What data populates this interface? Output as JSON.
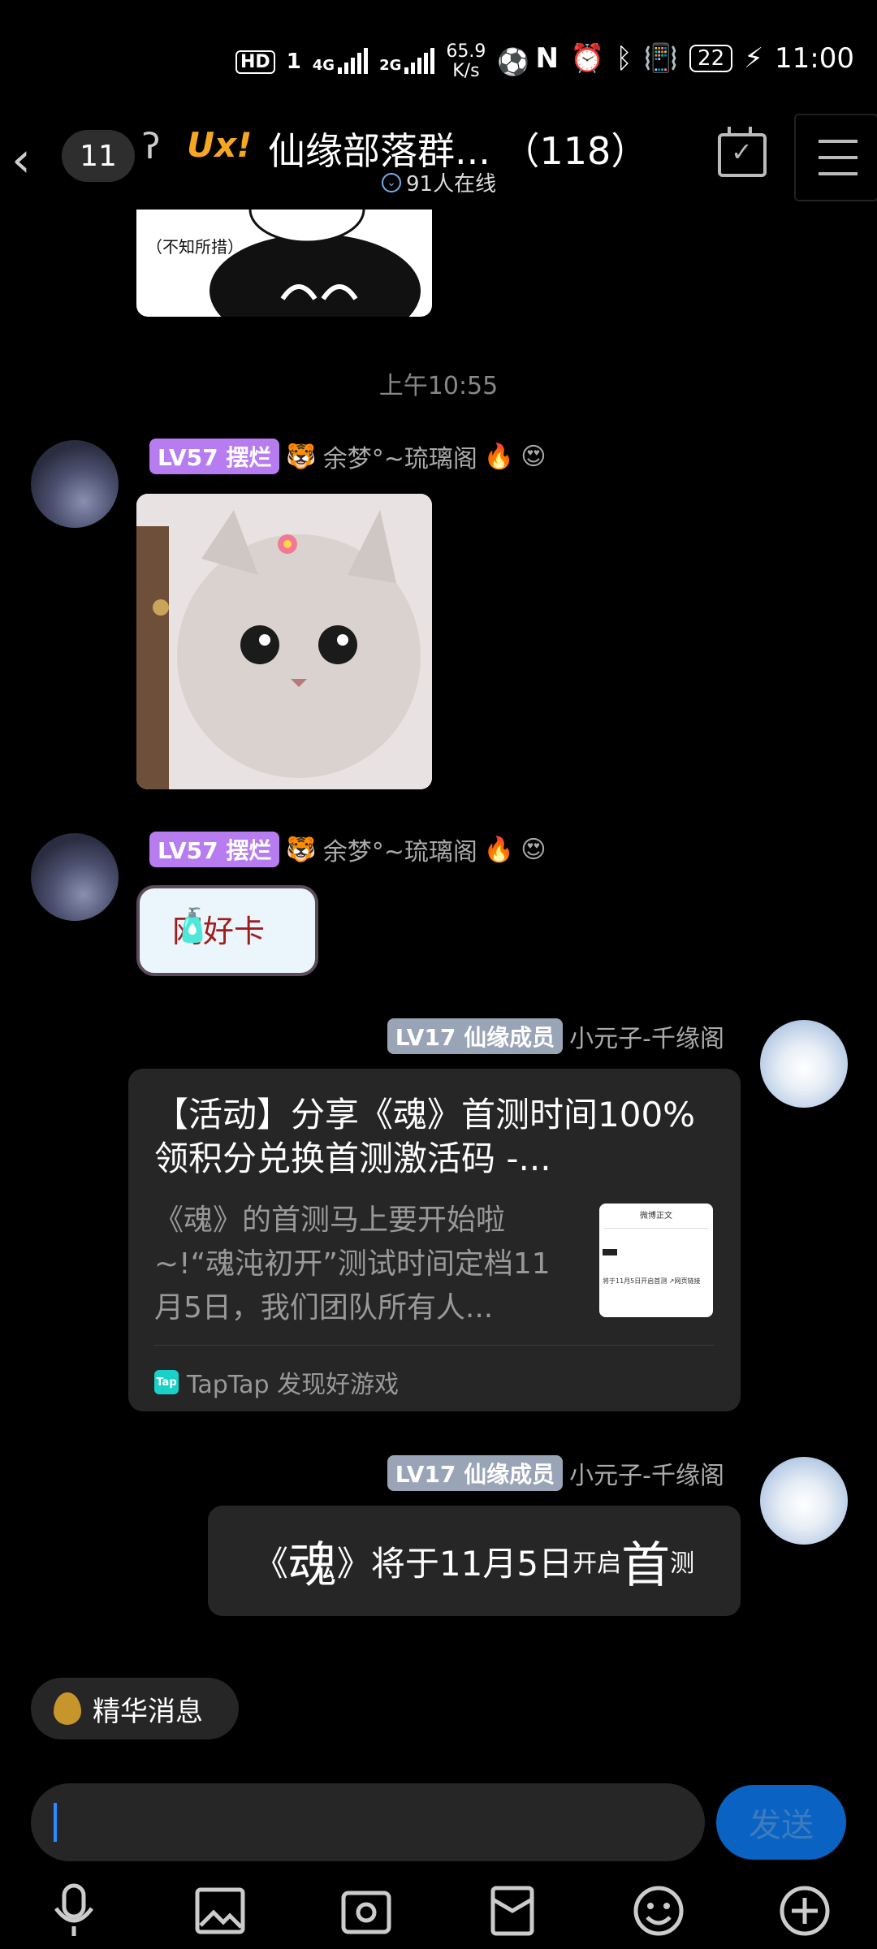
{
  "status": {
    "hd": "HD",
    "sim": "1",
    "net_4g": "4G",
    "net_2g": "2G",
    "speed": "65.9",
    "speed_unit": "K/s",
    "battery": "22",
    "time": "11:00",
    "nfc": "N"
  },
  "header": {
    "unread": "11",
    "logo": "Ux!",
    "title": "仙缘部落群...  （118）",
    "online": "91人在线"
  },
  "partial_image": {
    "caption": "（不知所措）"
  },
  "time_separator": "上午10:55",
  "messages": [
    {
      "badge": "LV57 摆烂",
      "name": "余梦°~琉璃阁",
      "emoji": "🔥",
      "emoji2": "😍"
    },
    {
      "badge": "LV57 摆烂",
      "name": "余梦°~琉璃阁",
      "emoji": "🔥",
      "emoji2": "😍",
      "sticker_text": "网好卡"
    },
    {
      "badge": "LV17 仙缘成员",
      "name": "小元子-千缘阁",
      "card": {
        "title": "【活动】分享《魂》首测时间100%领积分兑换首测激活码 -...",
        "desc": "《魂》的首测马上要开始啦~!“魂沌初开”测试时间定档11月5日，我们团队所有人...",
        "source": "TapTap 发现好游戏",
        "source_icon": "Tap",
        "thumb_title": "微博正文",
        "thumb_text": "将于11月5日开启首测 ↗网页链接"
      }
    },
    {
      "badge": "LV17 仙缘成员",
      "name": "小元子-千缘阁",
      "text_parts": [
        "《",
        "魂",
        "》",
        "将于11月5日",
        "开启",
        "首",
        "测"
      ]
    }
  ],
  "essence_label": "精华消息",
  "send_label": "发送",
  "icons": [
    "mic-icon",
    "image-icon",
    "camera-icon",
    "red-packet-icon",
    "emoji-icon",
    "plus-icon"
  ]
}
